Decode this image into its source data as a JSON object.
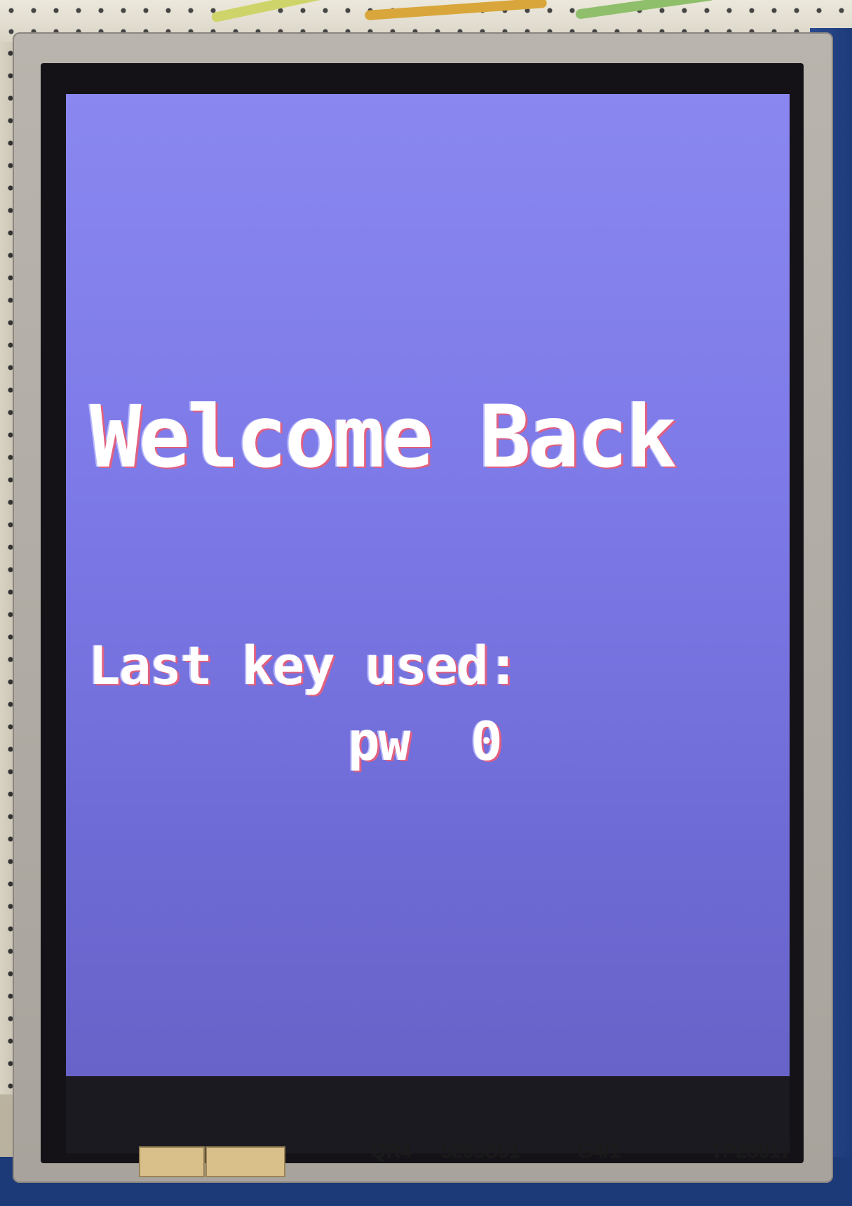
{
  "screen": {
    "welcome_text": "Welcome Back",
    "last_key_label": "Last key used:",
    "last_key_value": "pw  0",
    "background_color": "#7d7ae8",
    "text_color": "#ffffff"
  },
  "module_markings": {
    "label_1": "QR4",
    "label_2": "5265S01",
    "label_3": "G4/1",
    "label_4": "TP28017"
  }
}
